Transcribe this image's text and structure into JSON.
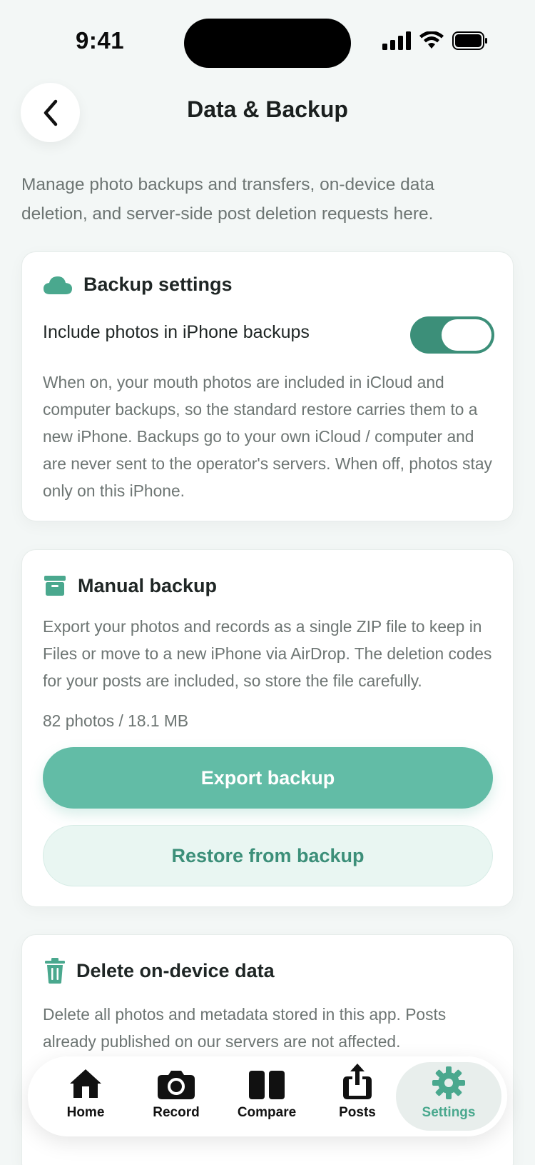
{
  "status_bar": {
    "time": "9:41"
  },
  "header": {
    "title": "Data & Backup"
  },
  "intro": "Manage photo backups and transfers, on-device data deletion, and server-side post deletion requests here.",
  "backup_settings": {
    "title": "Backup settings",
    "toggle_label": "Include photos in iPhone backups",
    "toggle_on": true,
    "description": "When on, your mouth photos are included in iCloud and computer backups, so the standard restore carries them to a new iPhone. Backups go to your own iCloud / computer and are never sent to the operator's servers. When off, photos stay only on this iPhone."
  },
  "manual_backup": {
    "title": "Manual backup",
    "description": "Export your photos and records as a single ZIP file to keep in Files or move to a new iPhone via AirDrop. The deletion codes for your posts are included, so store the file carefully.",
    "stats": "82 photos / 18.1 MB",
    "export_label": "Export backup",
    "restore_label": "Restore from backup"
  },
  "delete_data": {
    "title": "Delete on-device data",
    "description": "Delete all photos and metadata stored in this app. Posts already published on our servers are not affected."
  },
  "tabs": [
    {
      "label": "Home",
      "icon": "house-icon"
    },
    {
      "label": "Record",
      "icon": "camera-icon"
    },
    {
      "label": "Compare",
      "icon": "split-view-icon"
    },
    {
      "label": "Posts",
      "icon": "share-icon"
    },
    {
      "label": "Settings",
      "icon": "gear-icon"
    }
  ],
  "colors": {
    "accent": "#62bca6",
    "accent_dark": "#3c8f79",
    "background": "#f3f7f6"
  }
}
